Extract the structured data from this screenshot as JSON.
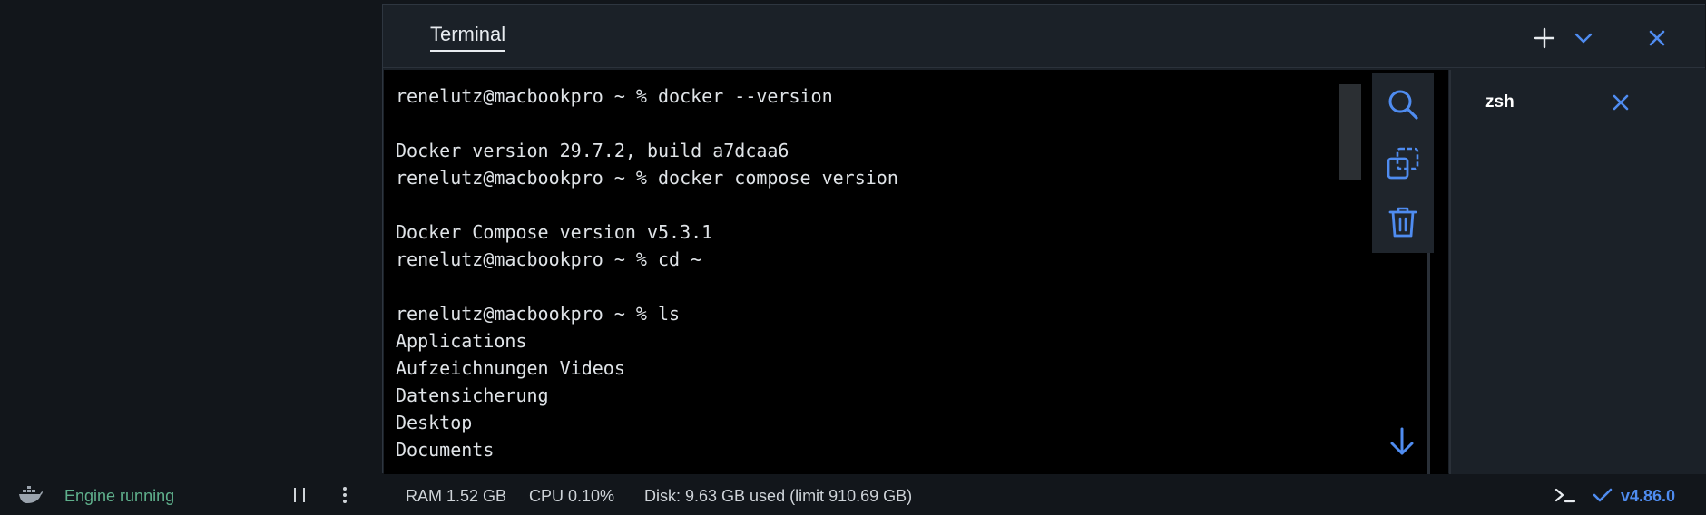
{
  "panel": {
    "tab_label": "Terminal",
    "accent": "#4f8cf0"
  },
  "terminal": {
    "lines": [
      "renelutz@macbookpro ~ % docker --version",
      "",
      "Docker version 29.7.2, build a7dcaa6",
      "renelutz@macbookpro ~ % docker compose version",
      "",
      "Docker Compose version v5.3.1",
      "renelutz@macbookpro ~ % cd ~",
      "",
      "renelutz@macbookpro ~ % ls",
      "Applications",
      "Aufzeichnungen Videos",
      "Datensicherung",
      "Desktop",
      "Documents"
    ],
    "tools": [
      "search-icon",
      "copy-icon",
      "trash-icon"
    ]
  },
  "sessions": [
    {
      "name": "zsh"
    }
  ],
  "status": {
    "engine": "Engine running",
    "engine_color": "#5fb08c",
    "ram": "RAM 1.52 GB",
    "cpu": "CPU 0.10%",
    "disk": "Disk: 9.63 GB used (limit 910.69 GB)",
    "version": "v4.86.0"
  }
}
